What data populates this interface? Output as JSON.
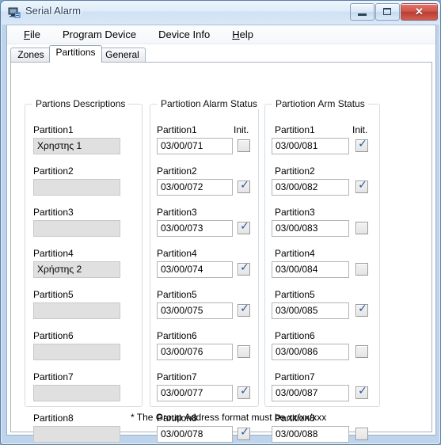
{
  "window": {
    "title": "Serial Alarm",
    "icon": "app-form-icon",
    "buttons": {
      "minimize": "minimize-icon",
      "maximize": "maximize-icon",
      "close": "✕"
    }
  },
  "menubar": {
    "items": [
      {
        "label": "File",
        "accel": "F"
      },
      {
        "label": "Program Device",
        "accel": ""
      },
      {
        "label": "Device Info",
        "accel": ""
      },
      {
        "label": "Help",
        "accel": "H"
      }
    ]
  },
  "tabs": [
    {
      "label": "Zones",
      "selected": false
    },
    {
      "label": "Partitions",
      "selected": true
    },
    {
      "label": "General",
      "selected": false
    }
  ],
  "groups": {
    "descriptions": {
      "title": "Partions Descriptions",
      "rows": [
        {
          "label": "Partition1",
          "value": "Χρηστης 1"
        },
        {
          "label": "Partition2",
          "value": ""
        },
        {
          "label": "Partition3",
          "value": ""
        },
        {
          "label": "Partition4",
          "value": "Χρήστης 2"
        },
        {
          "label": "Partition5",
          "value": ""
        },
        {
          "label": "Partition6",
          "value": ""
        },
        {
          "label": "Partition7",
          "value": ""
        },
        {
          "label": "Partition8",
          "value": ""
        }
      ]
    },
    "alarm_status": {
      "title": "Partiotion Alarm Status",
      "init_header": "Init.",
      "rows": [
        {
          "label": "Partition1",
          "value": "03/00/071",
          "init": false
        },
        {
          "label": "Partition2",
          "value": "03/00/072",
          "init": true
        },
        {
          "label": "Partition3",
          "value": "03/00/073",
          "init": true
        },
        {
          "label": "Partition4",
          "value": "03/00/074",
          "init": true
        },
        {
          "label": "Partition5",
          "value": "03/00/075",
          "init": true
        },
        {
          "label": "Partition6",
          "value": "03/00/076",
          "init": false
        },
        {
          "label": "Partition7",
          "value": "03/00/077",
          "init": true
        },
        {
          "label": "Partition8",
          "value": "03/00/078",
          "init": true
        }
      ]
    },
    "arm_status": {
      "title": "Partiotion Arm Status",
      "init_header": "Init.",
      "rows": [
        {
          "label": "Partition1",
          "value": "03/00/081",
          "init": true
        },
        {
          "label": "Partition2",
          "value": "03/00/082",
          "init": true
        },
        {
          "label": "Partition3",
          "value": "03/00/083",
          "init": false
        },
        {
          "label": "Partition4",
          "value": "03/00/084",
          "init": false
        },
        {
          "label": "Partition5",
          "value": "03/00/085",
          "init": true
        },
        {
          "label": "Partition6",
          "value": "03/00/086",
          "init": false
        },
        {
          "label": "Partition7",
          "value": "03/00/087",
          "init": true
        },
        {
          "label": "Partition8",
          "value": "03/00/088",
          "init": false
        }
      ]
    }
  },
  "footnote": "* The Group Address format must be xx/xx/xxx",
  "colors": {
    "accent": "#2a57a5",
    "close_button": "#c0392b",
    "disabled_field": "#e0e0e0",
    "window_frame": "#5b7fa6"
  }
}
